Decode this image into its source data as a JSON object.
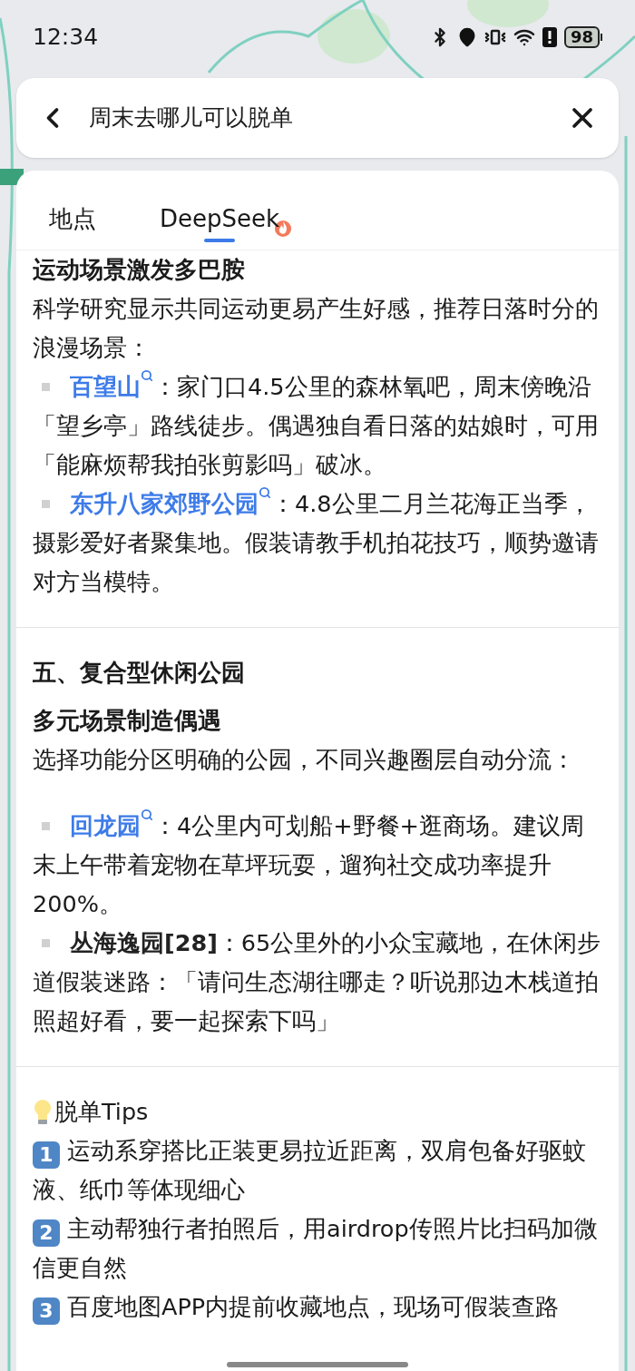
{
  "status_bar": {
    "time": "12:34",
    "battery": "98"
  },
  "search": {
    "value": "周末去哪儿可以脱单"
  },
  "tabs": [
    {
      "label": "地点",
      "selected": false,
      "hot": false
    },
    {
      "label": "DeepSeek",
      "selected": true,
      "hot": true
    }
  ],
  "content": [
    {
      "kind": "subheading",
      "text": "运动场景激发多巴胺"
    },
    {
      "kind": "paragraph",
      "text": "科学研究显示共同运动更易产生好感，推荐日落时分的浪漫场景："
    },
    {
      "kind": "bullet",
      "place": "百望山",
      "link": true,
      "text": "：家门口4.5公里的森林氧吧，周末傍晚沿「望乡亭」路线徒步。偶遇独自看日落的姑娘时，可用「能麻烦帮我拍张剪影吗」破冰。"
    },
    {
      "kind": "bullet",
      "place": "东升八家郊野公园",
      "link": true,
      "text": "：4.8公里二月兰花海正当季，摄影爱好者聚集地。假装请教手机拍花技巧，顺势邀请对方当模特。"
    },
    {
      "kind": "divider"
    },
    {
      "kind": "heading",
      "text": "五、复合型休闲公园"
    },
    {
      "kind": "subheading",
      "text": "多元场景制造偶遇"
    },
    {
      "kind": "paragraph",
      "text": "选择功能分区明确的公园，不同兴趣圈层自动分流："
    },
    {
      "kind": "blank"
    },
    {
      "kind": "bullet",
      "place": "回龙园",
      "link": true,
      "text": "：4公里内可划船+野餐+逛商场。建议周末上午带着宠物在草坪玩耍，遛狗社交成功率提升200%。"
    },
    {
      "kind": "bullet",
      "place": "丛海逸园[28]",
      "link": false,
      "text": "：65公里外的小众宝藏地，在休闲步道假装迷路：「请问生态湖往哪走？听说那边木栈道拍照超好看，要一起探索下吗」"
    },
    {
      "kind": "divider"
    },
    {
      "kind": "tips_title",
      "text": "脱单Tips"
    },
    {
      "kind": "tip",
      "number": "1",
      "text": "运动系穿搭比正装更易拉近距离，双肩包备好驱蚊液、纸巾等体现细心"
    },
    {
      "kind": "tip",
      "number": "2",
      "text": "主动帮独行者拍照后，用airdrop传照片比扫码加微信更自然"
    },
    {
      "kind": "tip",
      "number": "3",
      "text": "百度地图APP内提前收藏地点，现场可假装查路"
    }
  ]
}
